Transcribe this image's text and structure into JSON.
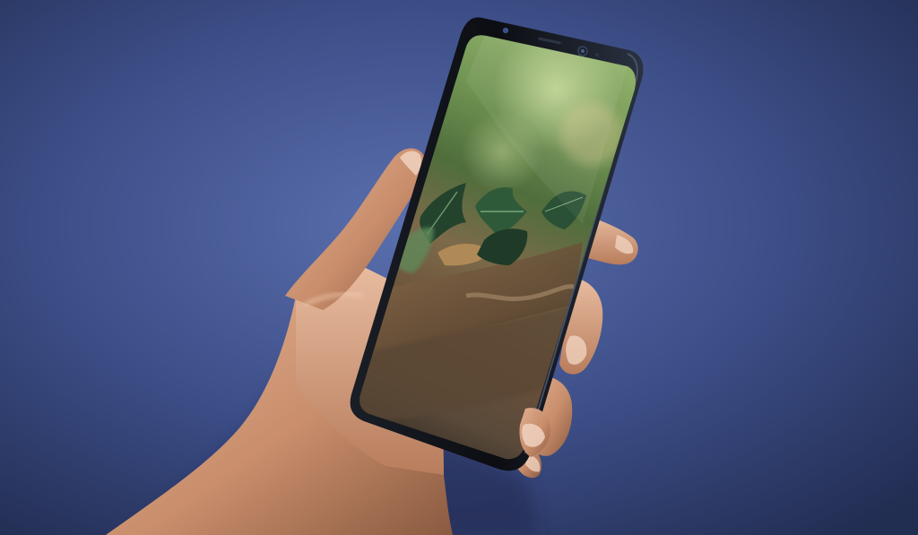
{
  "scene": {
    "subject": "hand-holding-smartphone",
    "colors": {
      "background_center": "#5a6fae",
      "background_edge": "#222d52",
      "skin_light": "#e2b193",
      "skin_mid": "#c98e6c",
      "skin_shadow": "#8a5a40",
      "phone_body": "#0b0d12",
      "phone_edge": "#2a3240",
      "leaf_dark": "#23432d",
      "leaf_light": "#5f8a5a",
      "bokeh_green": "#8fb06a",
      "wood_brown": "#6b5039"
    },
    "icons": [
      "front-camera-icon",
      "earpiece-speaker-icon",
      "iris-sensor-icon"
    ]
  }
}
